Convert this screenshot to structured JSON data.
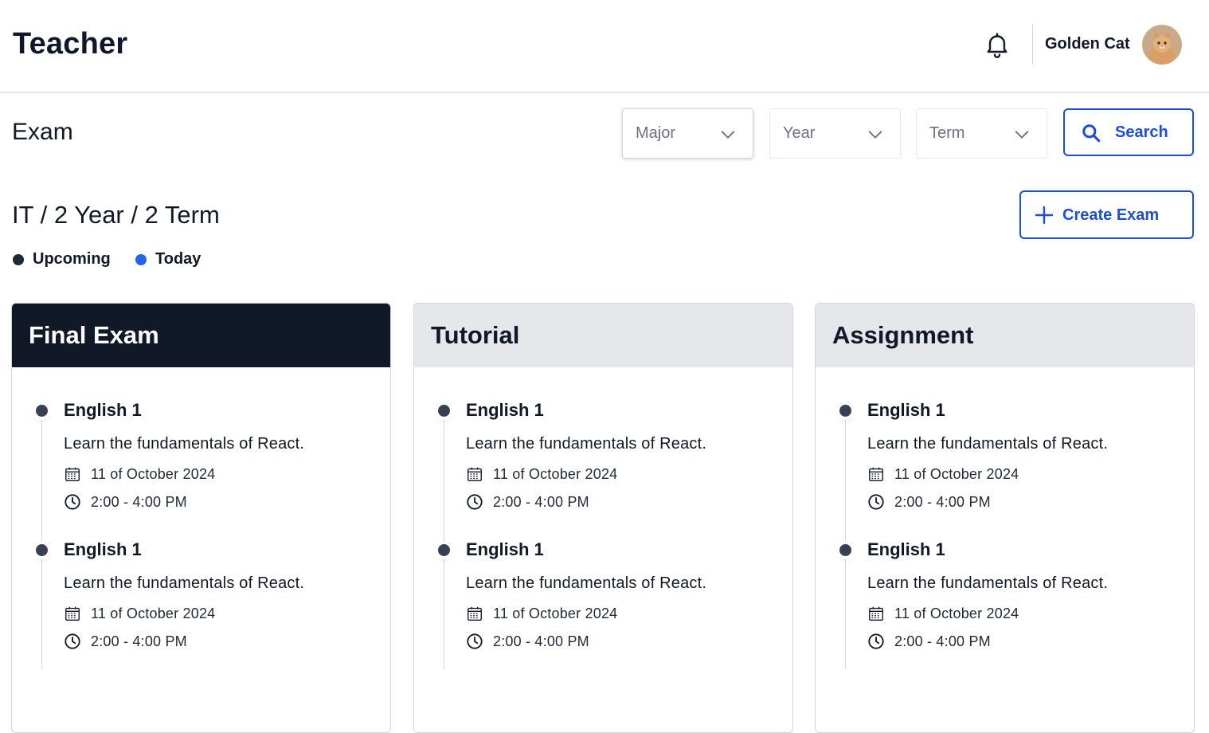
{
  "header": {
    "app_title": "Teacher",
    "user_name": "Golden Cat"
  },
  "filters": {
    "section_title": "Exam",
    "major_placeholder": "Major",
    "year_placeholder": "Year",
    "term_placeholder": "Term",
    "search_label": "Search"
  },
  "context": {
    "breadcrumb": "IT / 2 Year / 2 Term",
    "create_label": "Create Exam"
  },
  "legend": [
    {
      "label": "Upcoming",
      "color": "#1f2937"
    },
    {
      "label": "Today",
      "color": "#2563eb"
    }
  ],
  "cards": [
    {
      "title": "Final Exam",
      "items": [
        {
          "title": "English 1",
          "description": "Learn the fundamentals of React.",
          "date": "11 of October 2024",
          "time": "2:00 - 4:00 PM"
        },
        {
          "title": "English 1",
          "description": "Learn the fundamentals of React.",
          "date": "11 of October 2024",
          "time": "2:00 - 4:00 PM"
        }
      ]
    },
    {
      "title": "Tutorial",
      "items": [
        {
          "title": "English 1",
          "description": "Learn the fundamentals of React.",
          "date": "11 of October 2024",
          "time": "2:00 - 4:00 PM"
        },
        {
          "title": "English 1",
          "description": "Learn the fundamentals of React.",
          "date": "11 of October 2024",
          "time": "2:00 - 4:00 PM"
        }
      ]
    },
    {
      "title": "Assignment",
      "items": [
        {
          "title": "English 1",
          "description": "Learn the fundamentals of React.",
          "date": "11 of October 2024",
          "time": "2:00 - 4:00 PM"
        },
        {
          "title": "English 1",
          "description": "Learn the fundamentals of React.",
          "date": "11 of October 2024",
          "time": "2:00 - 4:00 PM"
        }
      ]
    }
  ],
  "colors": {
    "accent": "#1d4ed8",
    "active_card_header": "#111827",
    "card_header": "#e5e7eb"
  }
}
